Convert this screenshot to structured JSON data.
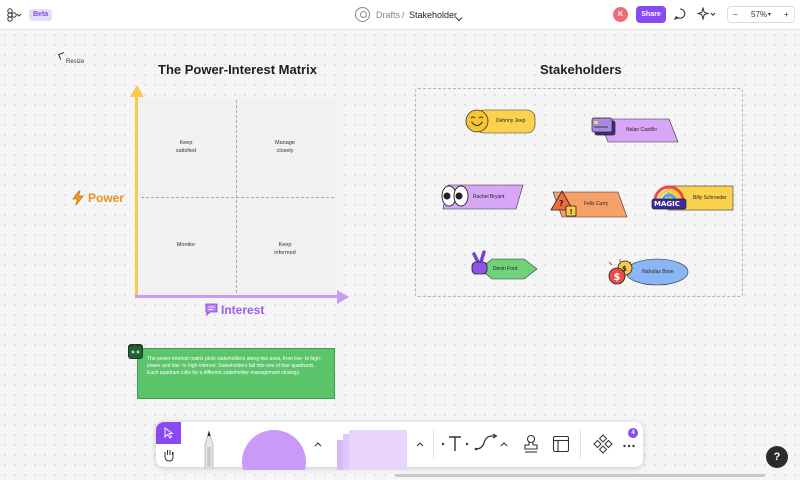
{
  "topbar": {
    "beta_badge": "Beta",
    "breadcrumb_parent": "Drafts",
    "breadcrumb_separator": "/",
    "file_name": "Stakeholder",
    "user_initial": "K",
    "share_label": "Share",
    "zoom_level": "57%",
    "zoom_out": "−",
    "zoom_in": "+"
  },
  "matrix": {
    "title": "The Power-Interest Matrix",
    "resize_label": "Resize",
    "y_axis_label": "Power",
    "x_axis_label": "Interest",
    "quadrants": {
      "top_left": "Keep\nsatisfied",
      "top_right": "Manage\nclosely",
      "bottom_left": "Monitor",
      "bottom_right": "Keep\ninformed"
    },
    "colors": {
      "power": "#f9c94c",
      "interest": "#c99af7",
      "power_text": "#e8901a",
      "interest_text": "#9b5de5"
    }
  },
  "stakeholders": {
    "title": "Stakeholders",
    "people": [
      {
        "name": "Dehnny Jeep",
        "shape": "rounded-rectangle",
        "color": "#fbd24d",
        "sticker": "smiley-face-icon"
      },
      {
        "name": "Nolan Castillo",
        "shape": "parallelogram",
        "color": "#d8a6f7",
        "sticker": "credit-card-icon"
      },
      {
        "name": "Rachel Bryant",
        "shape": "parallelogram",
        "color": "#d8a6f7",
        "sticker": "eyes-icon"
      },
      {
        "name": "Felix Curry",
        "shape": "parallelogram",
        "color": "#f6a06a",
        "sticker": "warning-question-icon"
      },
      {
        "name": "Billy Schroeder",
        "shape": "rectangle",
        "color": "#fbd24d",
        "sticker": "magic-rainbow-icon"
      },
      {
        "name": "Devin Ford",
        "shape": "diamond",
        "color": "#6fd17a",
        "sticker": "peace-hand-icon"
      },
      {
        "name": "Nickolas Bose",
        "shape": "ellipse",
        "color": "#8ab6f5",
        "sticker": "money-bag-icon"
      }
    ]
  },
  "note": {
    "text": "The power-interest matrix plots stakeholders along two axes, from low- to high-power and low- to high-interest. Stakeholders fall into one of four quadrants. Each quadrant calls for a different stakeholder-management strategy.",
    "color": "#5cc46b"
  },
  "toolbar": {
    "notification_count": "4",
    "help_label": "?"
  }
}
